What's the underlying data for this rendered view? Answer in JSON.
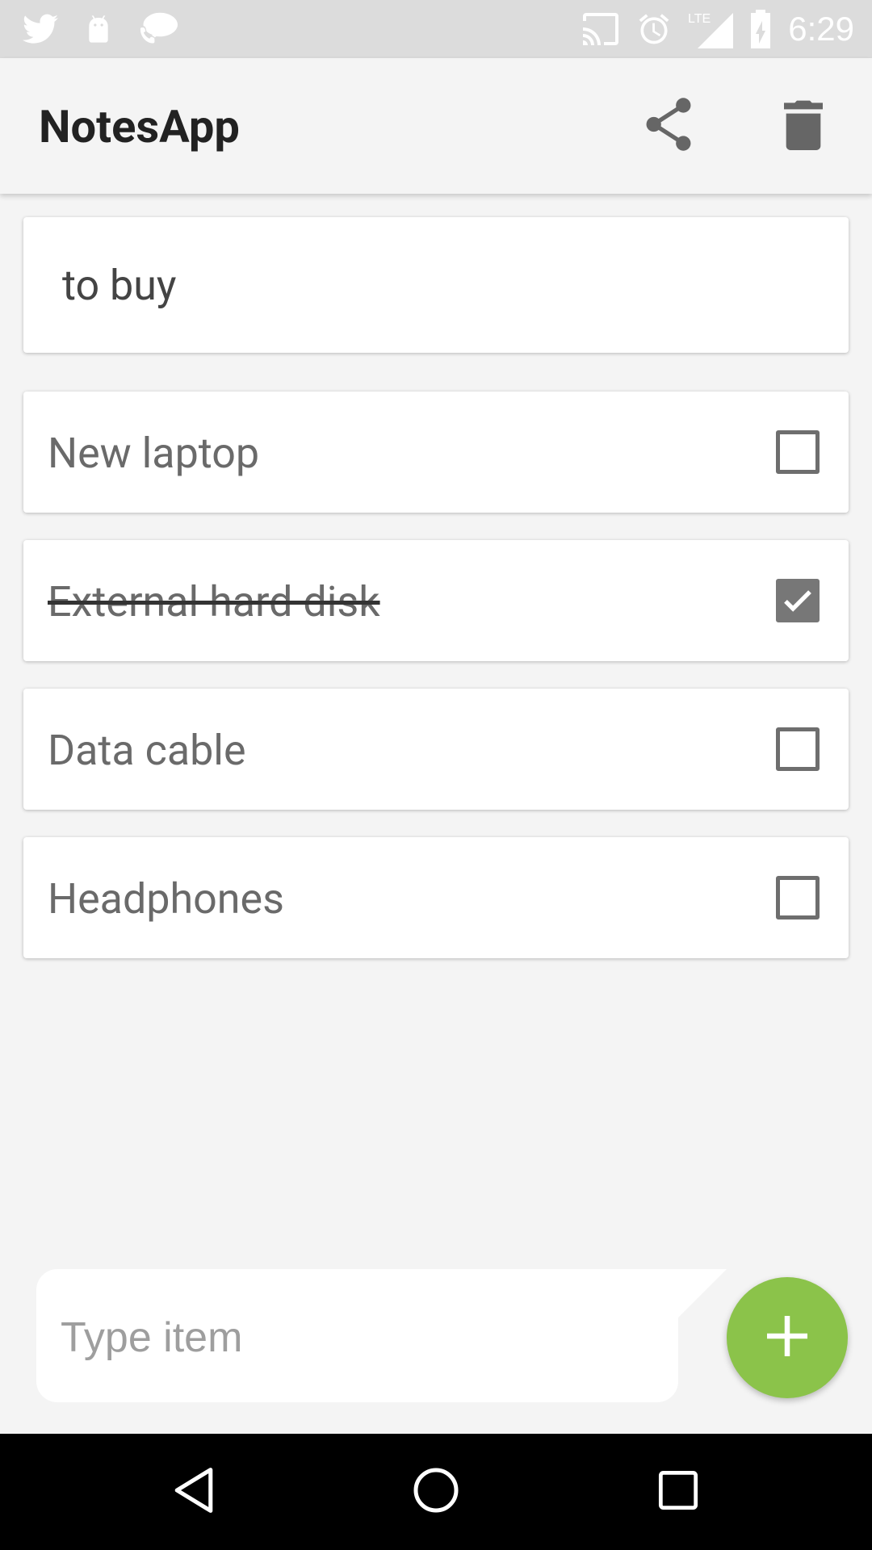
{
  "status_bar": {
    "time": "6:29",
    "left_icons": [
      "twitter-icon",
      "android-icon",
      "phone-chat-icon"
    ],
    "right_icons": [
      "cast-icon",
      "alarm-icon",
      "lte-signal-icon",
      "battery-charging-icon"
    ],
    "network_label": "LTE"
  },
  "app_bar": {
    "title": "NotesApp",
    "actions": [
      "share-icon",
      "delete-icon"
    ]
  },
  "note": {
    "title": "to buy",
    "items": [
      {
        "label": "New laptop",
        "checked": false
      },
      {
        "label": "External hard disk",
        "checked": true
      },
      {
        "label": "Data cable",
        "checked": false
      },
      {
        "label": "Headphones",
        "checked": false
      }
    ]
  },
  "new_item": {
    "placeholder": "Type item",
    "value": ""
  },
  "fab": {
    "icon": "plus-icon"
  },
  "colors": {
    "accent": "#8bc34a",
    "background": "#f4f4f4",
    "status_bar": "#dcdcdc"
  },
  "nav_bar": {
    "buttons": [
      "back-icon",
      "home-icon",
      "recent-apps-icon"
    ]
  }
}
